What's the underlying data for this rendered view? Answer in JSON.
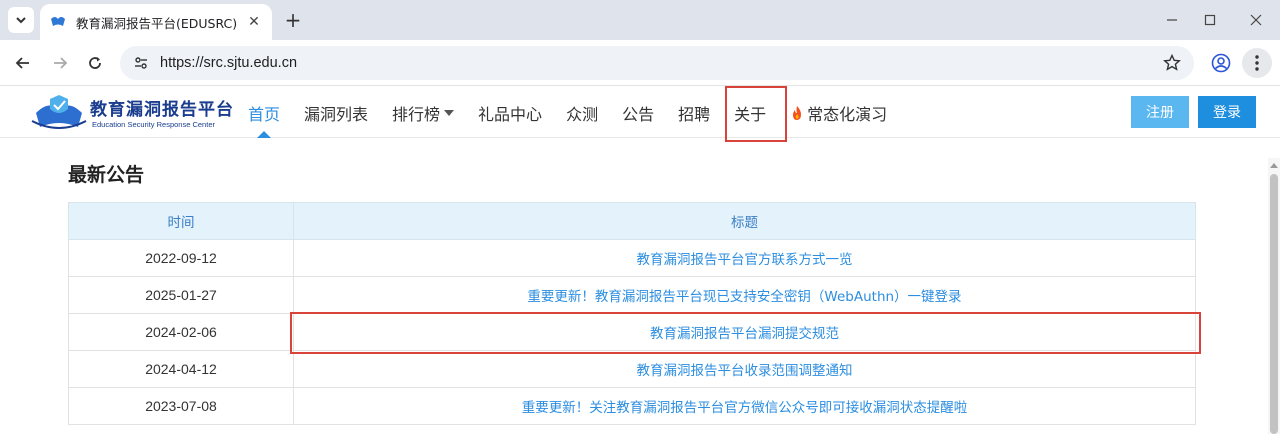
{
  "browser": {
    "tab_title": "教育漏洞报告平台(EDUSRC)",
    "url": "https://src.sjtu.edu.cn"
  },
  "site": {
    "logo_cn": "教育漏洞报告平台",
    "logo_en": "Education Security Response Center",
    "nav": [
      {
        "label": "首页"
      },
      {
        "label": "漏洞列表"
      },
      {
        "label": "排行榜"
      },
      {
        "label": "礼品中心"
      },
      {
        "label": "众测"
      },
      {
        "label": "公告"
      },
      {
        "label": "招聘"
      },
      {
        "label": "关于"
      },
      {
        "label": "常态化演习"
      }
    ],
    "register_label": "注册",
    "login_label": "登录"
  },
  "content": {
    "title": "最新公告",
    "columns": [
      "时间",
      "标题"
    ],
    "rows": [
      {
        "date": "2022-09-12",
        "title": "教育漏洞报告平台官方联系方式一览"
      },
      {
        "date": "2025-01-27",
        "title": "重要更新！教育漏洞报告平台现已支持安全密钥（WebAuthn）一键登录"
      },
      {
        "date": "2024-02-06",
        "title": "教育漏洞报告平台漏洞提交规范"
      },
      {
        "date": "2024-04-12",
        "title": "教育漏洞报告平台收录范围调整通知"
      },
      {
        "date": "2023-07-08",
        "title": "重要更新！关注教育漏洞报告平台官方微信公众号即可接收漏洞状态提醒啦"
      }
    ]
  },
  "colors": {
    "accent": "#2c8ee0",
    "highlight": "#d9433a",
    "table_header_bg": "#e3f2fb"
  }
}
